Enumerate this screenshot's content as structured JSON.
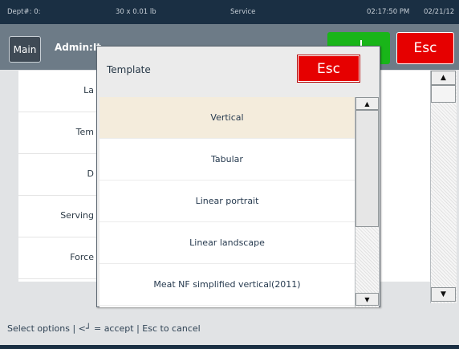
{
  "statusbar": {
    "dept": "Dept#: 0:",
    "weight": "30 x 0.01 lb",
    "mode": "Service",
    "time": "02:17:50 PM",
    "date": "02/21/12"
  },
  "titlebar": {
    "main_label": "Main",
    "admin_label": "Admin:It",
    "accept_icon": "enter-arrow-icon",
    "esc_label": "Esc"
  },
  "background_list": {
    "items": [
      "La",
      "Tem",
      "D",
      "Serving",
      "Force"
    ]
  },
  "dialog": {
    "title": "Template",
    "esc_label": "Esc",
    "options": [
      {
        "label": "Vertical",
        "selected": true
      },
      {
        "label": "Tabular",
        "selected": false
      },
      {
        "label": "Linear portrait",
        "selected": false
      },
      {
        "label": "Linear landscape",
        "selected": false
      },
      {
        "label": "Meat NF simplified vertical(2011)",
        "selected": false
      }
    ]
  },
  "hint": {
    "text": "Select options | <┘ = accept | Esc to cancel"
  },
  "colors": {
    "status_bg": "#1a2f43",
    "title_bg": "#6d7b87",
    "accept_green": "#19b519",
    "esc_red": "#e60000",
    "selected_row": "#f4ecdc"
  }
}
